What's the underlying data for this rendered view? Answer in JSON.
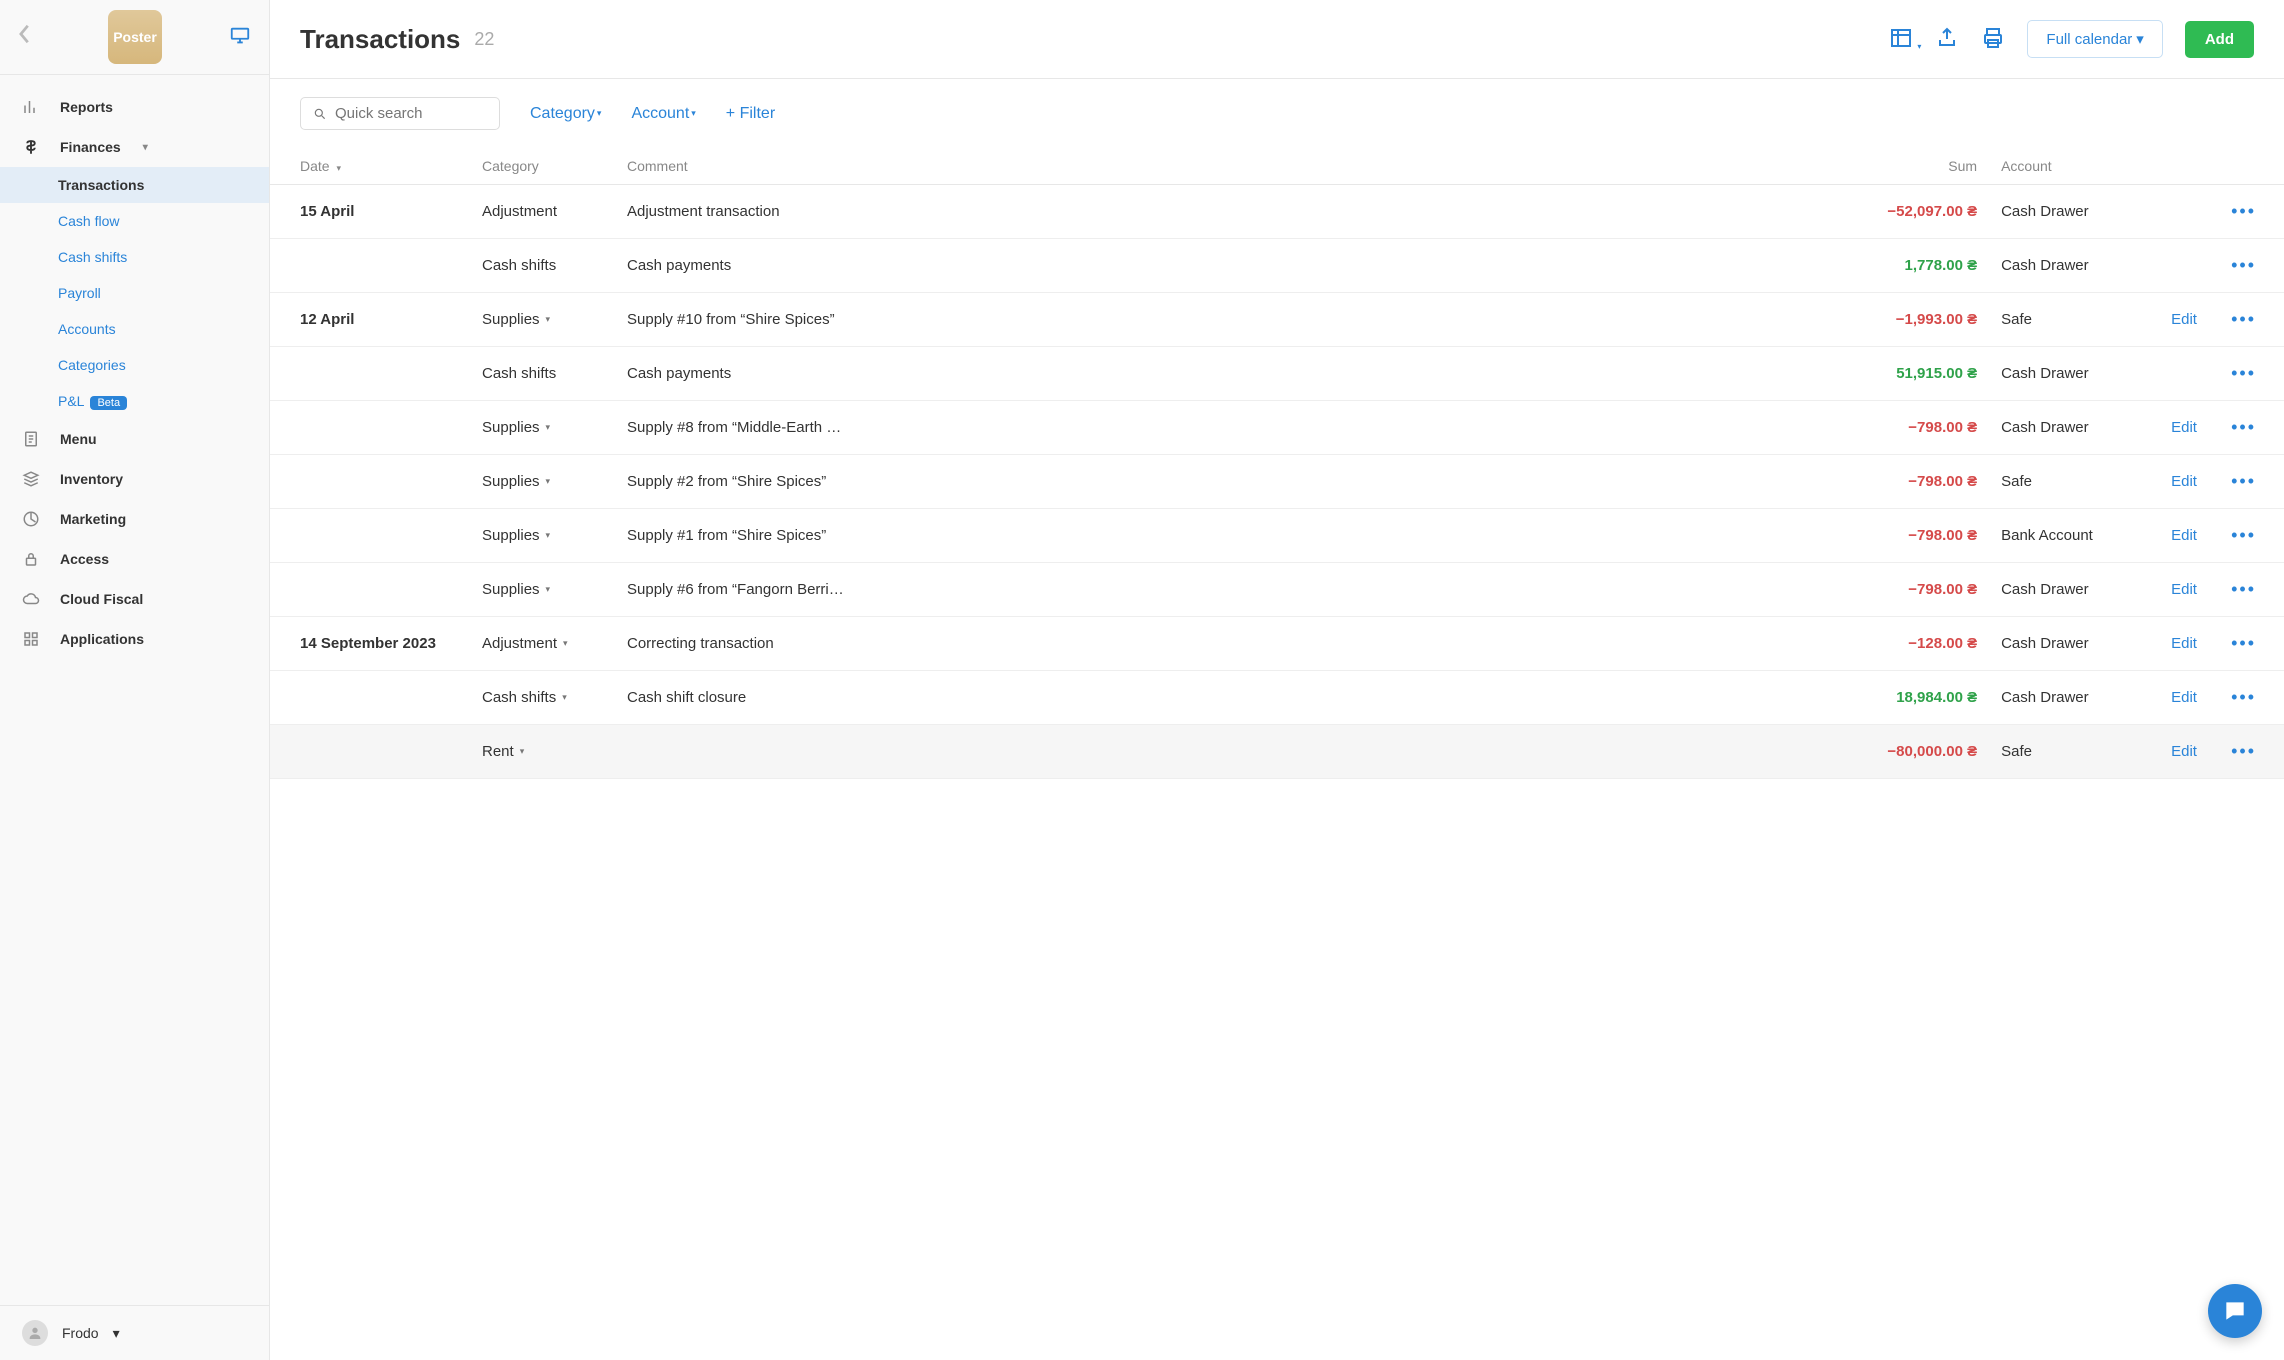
{
  "logo_text": "Poster",
  "sidebar": {
    "nav": [
      {
        "icon": "reports",
        "label": "Reports"
      },
      {
        "icon": "finances",
        "label": "Finances",
        "expanded": true,
        "sub": [
          {
            "label": "Transactions",
            "active": true
          },
          {
            "label": "Cash flow"
          },
          {
            "label": "Cash shifts"
          },
          {
            "label": "Payroll"
          },
          {
            "label": "Accounts"
          },
          {
            "label": "Categories"
          },
          {
            "label": "P&L",
            "badge": "Beta"
          }
        ]
      },
      {
        "icon": "menu",
        "label": "Menu"
      },
      {
        "icon": "inventory",
        "label": "Inventory"
      },
      {
        "icon": "marketing",
        "label": "Marketing"
      },
      {
        "icon": "access",
        "label": "Access"
      },
      {
        "icon": "cloud",
        "label": "Cloud Fiscal"
      },
      {
        "icon": "apps",
        "label": "Applications"
      }
    ],
    "user": "Frodo"
  },
  "header": {
    "title": "Transactions",
    "count": "22",
    "calendar_btn": "Full calendar",
    "add_btn": "Add"
  },
  "toolbar": {
    "search_placeholder": "Quick search",
    "category_label": "Category",
    "account_label": "Account",
    "filter_label": "+ Filter"
  },
  "table": {
    "headers": {
      "date": "Date",
      "category": "Category",
      "comment": "Comment",
      "sum": "Sum",
      "account": "Account"
    },
    "edit_label": "Edit",
    "rows": [
      {
        "date": "15 April",
        "category": "Adjustment",
        "cat_dropdown": false,
        "comment": "Adjustment transaction",
        "sum": "−52,097.00 ₴",
        "sum_class": "neg",
        "account": "Cash Drawer",
        "editable": false
      },
      {
        "date": "",
        "category": "Cash shifts",
        "cat_dropdown": false,
        "comment": "Cash payments",
        "sum": "1,778.00 ₴",
        "sum_class": "pos",
        "account": "Cash Drawer",
        "editable": false
      },
      {
        "date": "12 April",
        "category": "Supplies",
        "cat_dropdown": true,
        "comment": "Supply #10 from “Shire Spices”",
        "sum": "−1,993.00 ₴",
        "sum_class": "neg",
        "account": "Safe",
        "editable": true
      },
      {
        "date": "",
        "category": "Cash shifts",
        "cat_dropdown": false,
        "comment": "Cash payments",
        "sum": "51,915.00 ₴",
        "sum_class": "pos",
        "account": "Cash Drawer",
        "editable": false
      },
      {
        "date": "",
        "category": "Supplies",
        "cat_dropdown": true,
        "comment": "Supply #8 from “Middle-Earth …",
        "sum": "−798.00 ₴",
        "sum_class": "neg",
        "account": "Cash Drawer",
        "editable": true
      },
      {
        "date": "",
        "category": "Supplies",
        "cat_dropdown": true,
        "comment": "Supply #2 from “Shire Spices”",
        "sum": "−798.00 ₴",
        "sum_class": "neg",
        "account": "Safe",
        "editable": true
      },
      {
        "date": "",
        "category": "Supplies",
        "cat_dropdown": true,
        "comment": "Supply #1 from “Shire Spices”",
        "sum": "−798.00 ₴",
        "sum_class": "neg",
        "account": "Bank Account",
        "editable": true
      },
      {
        "date": "",
        "category": "Supplies",
        "cat_dropdown": true,
        "comment": "Supply #6 from “Fangorn Berri…",
        "sum": "−798.00 ₴",
        "sum_class": "neg",
        "account": "Cash Drawer",
        "editable": true
      },
      {
        "date": "14 September 2023",
        "category": "Adjustment",
        "cat_dropdown": true,
        "comment": "Correcting transaction",
        "sum": "−128.00 ₴",
        "sum_class": "neg",
        "account": "Cash Drawer",
        "editable": true
      },
      {
        "date": "",
        "category": "Cash shifts",
        "cat_dropdown": true,
        "comment": "Cash shift closure",
        "sum": "18,984.00 ₴",
        "sum_class": "pos",
        "account": "Cash Drawer",
        "editable": true
      },
      {
        "date": "",
        "category": "Rent",
        "cat_dropdown": true,
        "comment": "",
        "sum": "−80,000.00 ₴",
        "sum_class": "neg",
        "account": "Safe",
        "editable": true,
        "hovered": true
      }
    ]
  }
}
